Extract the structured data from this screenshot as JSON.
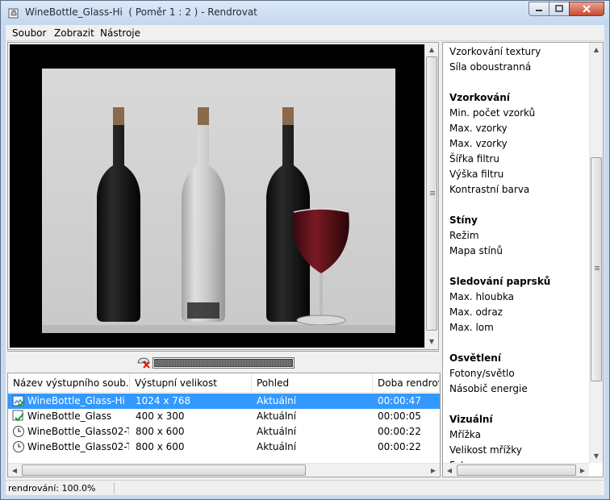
{
  "window": {
    "title": "WineBottle_Glass-Hi  ( Poměr 1 : 2 ) - Rendrovat"
  },
  "menu": {
    "items": [
      "Soubor",
      "Zobrazit",
      "Nástroje"
    ]
  },
  "progress": {
    "value": 1.0
  },
  "list": {
    "columns": [
      "Název výstupního soub...",
      "Výstupní velikost",
      "Pohled",
      "Doba rendrová"
    ],
    "rows": [
      {
        "icon": "image-done-icon",
        "name": "WineBottle_Glass-Hi",
        "size": "1024 x 768",
        "view": "Aktuální",
        "time": "00:00:47",
        "selected": true
      },
      {
        "icon": "check-doc-icon",
        "name": "WineBottle_Glass",
        "size": "400 x 300",
        "view": "Aktuální",
        "time": "00:00:05",
        "selected": false
      },
      {
        "icon": "clock-icon",
        "name": "WineBottle_Glass02-T...",
        "size": "800 x 600",
        "view": "Aktuální",
        "time": "00:00:22",
        "selected": false
      },
      {
        "icon": "clock-icon",
        "name": "WineBottle_Glass02-T...",
        "size": "800 x 600",
        "view": "Aktuální",
        "time": "00:00:22",
        "selected": false
      }
    ]
  },
  "properties": {
    "items": [
      {
        "label": "Vzorkování textury",
        "header": false
      },
      {
        "label": "Síla oboustranná",
        "header": false
      },
      {
        "label": "Vzorkování",
        "header": true
      },
      {
        "label": "Min. počet vzorků",
        "header": false
      },
      {
        "label": "Max. vzorky",
        "header": false
      },
      {
        "label": "Max. vzorky",
        "header": false
      },
      {
        "label": "Šířka filtru",
        "header": false
      },
      {
        "label": "Výška filtru",
        "header": false
      },
      {
        "label": "Kontrastní barva",
        "header": false
      },
      {
        "label": "Stíny",
        "header": true
      },
      {
        "label": "Režim",
        "header": false
      },
      {
        "label": "Mapa stínů",
        "header": false
      },
      {
        "label": "Sledování paprsků",
        "header": true
      },
      {
        "label": "Max. hloubka",
        "header": false
      },
      {
        "label": "Max. odraz",
        "header": false
      },
      {
        "label": "Max. lom",
        "header": false
      },
      {
        "label": "Osvětlení",
        "header": true
      },
      {
        "label": "Fotony/světlo",
        "header": false
      },
      {
        "label": "Násobič energie",
        "header": false
      },
      {
        "label": "Vizuální",
        "header": true
      },
      {
        "label": "Mřížka",
        "header": false
      },
      {
        "label": "Velikost mřížky",
        "header": false
      },
      {
        "label": "Foton",
        "header": false
      }
    ]
  },
  "status": {
    "text": "rendrování: 100.0%"
  },
  "colors": {
    "selection": "#3399ff",
    "wine": "#5a0d18"
  }
}
